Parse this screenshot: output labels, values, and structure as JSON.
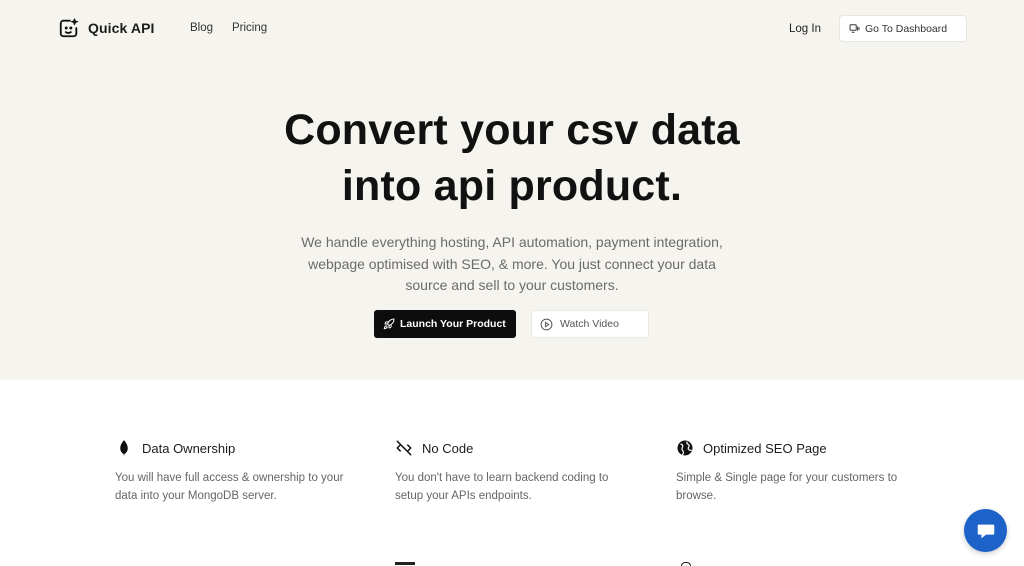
{
  "nav": {
    "logo_text": "Quick API",
    "links": [
      {
        "label": "Blog"
      },
      {
        "label": "Pricing"
      }
    ],
    "login_label": "Log In",
    "dashboard_label": "Go To Dashboard"
  },
  "hero": {
    "headline_line1": "Convert your csv data",
    "headline_line2": "into api product.",
    "subheadline_line1": "We handle everything hosting, API automation, payment integration,",
    "subheadline_line2": "webpage optimised with SEO, & more. You just connect your data",
    "subheadline_line3": "source and sell to your customers.",
    "primary_cta": "Launch Your Product",
    "secondary_cta": "Watch Video"
  },
  "features": [
    {
      "icon": "leaf-icon",
      "title": "Data Ownership",
      "desc_line1": "You will have full access & ownership to your",
      "desc_line2": "data into your MongoDB server."
    },
    {
      "icon": "code-off-icon",
      "title": "No Code",
      "desc_line1": "You don't have to learn backend coding to",
      "desc_line2": "setup your APIs endpoints."
    },
    {
      "icon": "globe-icon",
      "title": "Optimized SEO Page",
      "desc_line1": "Simple & Single page for your customers to",
      "desc_line2": "browse."
    }
  ],
  "colors": {
    "hero_bg": "#f6f4ee",
    "primary_button": "#0d0d0d",
    "chat_button": "#1d62c9"
  }
}
